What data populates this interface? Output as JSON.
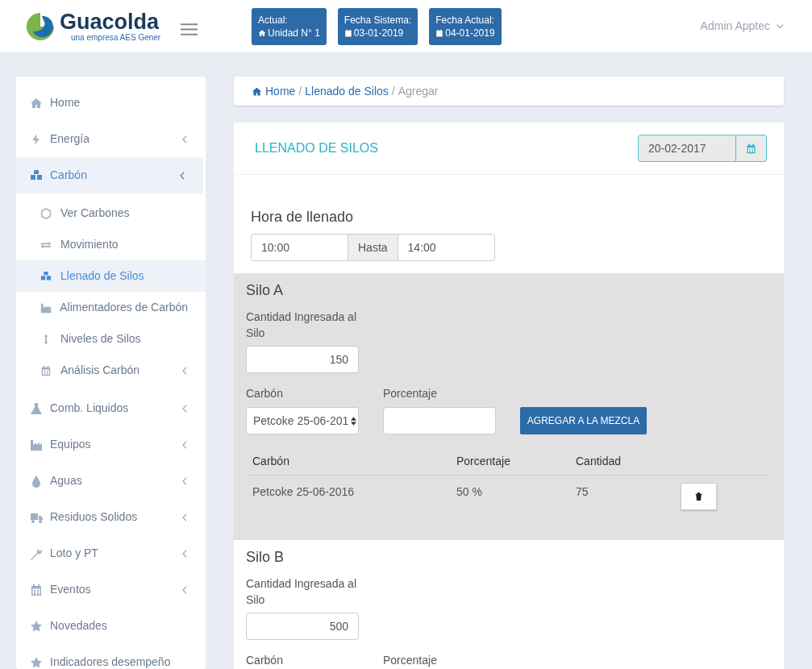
{
  "header": {
    "logo": {
      "name": "Guacolda",
      "tagline": "una empresa AES Gener"
    },
    "badges": [
      {
        "label": "Actual:",
        "kind": "home",
        "value": "Unidad N° 1"
      },
      {
        "label": "Fecha Sistema:",
        "kind": "calendar",
        "value": "03-01-2019"
      },
      {
        "label": "Fecha Actual:",
        "kind": "calendar",
        "value": "04-01-2019"
      }
    ],
    "user": "Admin Apptec"
  },
  "sidebar": {
    "items": [
      {
        "label": "Home",
        "kind": "home",
        "selected": false,
        "has_submenu": false
      },
      {
        "label": "Energía",
        "kind": "bolt",
        "selected": false,
        "has_submenu": true
      },
      {
        "label": "Carbón",
        "kind": "cubes",
        "selected": true,
        "has_submenu": true,
        "children": [
          {
            "label": "Ver Carbones",
            "kind": "cube",
            "selected": false,
            "has_submenu": false
          },
          {
            "label": "Movimiento",
            "kind": "exchange",
            "selected": false,
            "has_submenu": false
          },
          {
            "label": "Llenado de Silos",
            "kind": "cubes",
            "selected": true,
            "has_submenu": false
          },
          {
            "label": "Alimentadores de Carbón",
            "kind": "industry",
            "selected": false,
            "has_submenu": false
          },
          {
            "label": "Niveles de Silos",
            "kind": "updown",
            "selected": false,
            "has_submenu": false
          },
          {
            "label": "Análisis Carbón",
            "kind": "calendar",
            "selected": false,
            "has_submenu": true
          }
        ]
      },
      {
        "label": "Comb. Liquidos",
        "kind": "flask",
        "selected": false,
        "has_submenu": true
      },
      {
        "label": "Equipos",
        "kind": "industry",
        "selected": false,
        "has_submenu": true
      },
      {
        "label": "Aguas",
        "kind": "drop",
        "selected": false,
        "has_submenu": true
      },
      {
        "label": "Residuos Solidos",
        "kind": "truck",
        "selected": false,
        "has_submenu": true
      },
      {
        "label": "Loto y PT",
        "kind": "wrench",
        "selected": false,
        "has_submenu": true
      },
      {
        "label": "Eventos",
        "kind": "calendar",
        "selected": false,
        "has_submenu": true
      },
      {
        "label": "Novedades",
        "kind": "star",
        "selected": false,
        "has_submenu": false
      },
      {
        "label": "Indicadores desempeño",
        "kind": "star",
        "selected": false,
        "has_submenu": false
      }
    ]
  },
  "breadcrumb": {
    "separator": "/",
    "items": [
      {
        "label": "Home",
        "kind": "home",
        "current": false
      },
      {
        "label": "Llenado de Silos",
        "current": false
      },
      {
        "label": "Agregar",
        "current": true
      }
    ]
  },
  "form": {
    "title": "LLENADO DE SILOS",
    "date": "20-02-2017",
    "time": {
      "label": "Hora de llenado",
      "from": "10:00",
      "joiner": "Hasta",
      "to": "14:00"
    },
    "silos": [
      {
        "name": "Silo A",
        "shaded": true,
        "quantity_label": "Cantidad Ingresada al Silo",
        "quantity": "150",
        "carbon_label": "Carbón",
        "carbon": "Petcoke 25-06-201",
        "percent_label": "Porcentaje",
        "button": "AGREGAR A LA MEZCLA",
        "table": {
          "columns": [
            "Carbón",
            "Porcentaje",
            "Cantidad"
          ],
          "rows": [
            {
              "cells": [
                "Petcoke 25-06-2016",
                "50 %",
                "75"
              ]
            }
          ]
        }
      },
      {
        "name": "Silo B",
        "shaded": false,
        "quantity_label": "Cantidad Ingresada al Silo",
        "quantity": "500",
        "carbon_label": "Carbón",
        "percent_label": "Porcentaje"
      }
    ]
  }
}
